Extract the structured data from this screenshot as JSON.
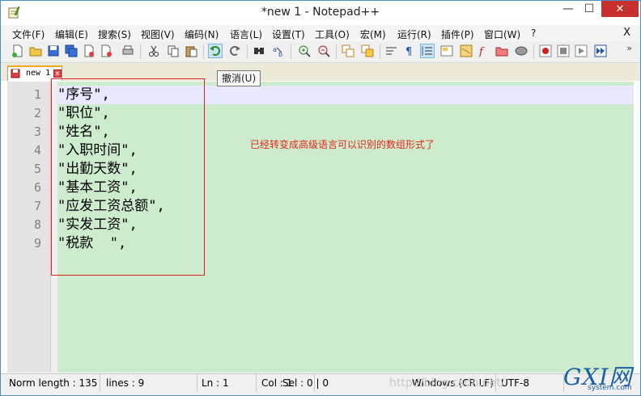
{
  "window": {
    "title": "*new 1 - Notepad++",
    "controls": {
      "minimize": "—",
      "maximize": "☐",
      "close": "✕"
    }
  },
  "menubar": {
    "items": [
      "文件(F)",
      "编辑(E)",
      "搜索(S)",
      "视图(V)",
      "编码(N)",
      "语言(L)",
      "设置(T)",
      "工具(O)",
      "宏(M)",
      "运行(R)",
      "插件(P)",
      "窗口(W)",
      "?"
    ],
    "close_label": "X"
  },
  "toolbar": {
    "tooltip": "撤消(U)",
    "overflow": "»"
  },
  "tabs": [
    {
      "label": "new 1",
      "close": "x"
    }
  ],
  "editor": {
    "line_numbers": [
      "1",
      "2",
      "3",
      "4",
      "5",
      "6",
      "7",
      "8",
      "9"
    ],
    "lines": [
      "\"序号\",",
      "\"职位\",",
      "\"姓名\",",
      "\"入职时间\",",
      "\"出勤天数\",",
      "\"基本工资\",",
      "\"应发工资总额\",",
      "\"实发工资\",",
      "\"税款  \","
    ],
    "annotation": "已经转变成高级语言可以识别的数组形式了"
  },
  "statusbar": {
    "length": "Norm length : 135",
    "lines": "lines : 9",
    "ln": "Ln : 1",
    "col": "Col : 1",
    "sel": "Sel : 0 | 0",
    "eol": "Windows (CR LF)",
    "encoding": "UTF-8",
    "watermark": "http://blog.csdn.net/"
  },
  "logo": {
    "main": "GXI网",
    "sub": "system.com"
  },
  "colors": {
    "editor_bg": "#cdeccd",
    "annotation": "#e8261c",
    "close_button": "#c7302c"
  }
}
